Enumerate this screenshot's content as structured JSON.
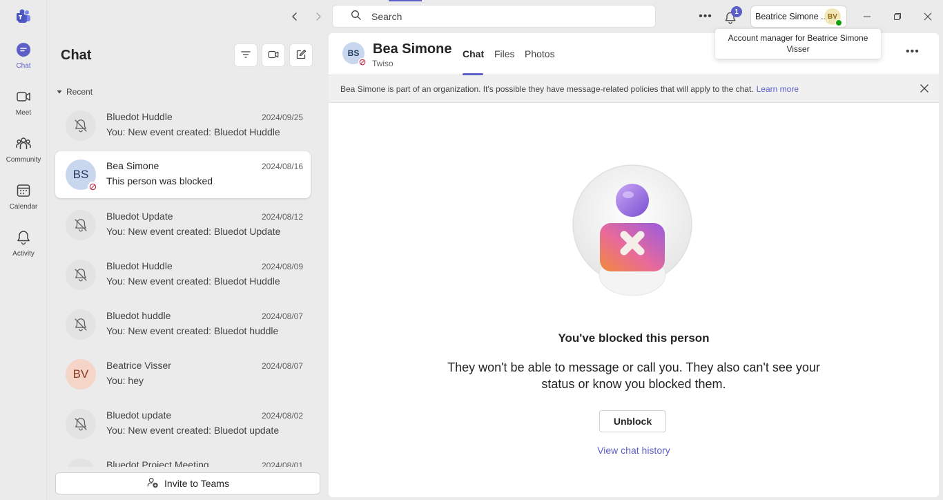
{
  "rail": {
    "items": [
      {
        "label": "Chat",
        "icon": "chat-icon"
      },
      {
        "label": "Meet",
        "icon": "video-icon"
      },
      {
        "label": "Community",
        "icon": "community-icon"
      },
      {
        "label": "Calendar",
        "icon": "calendar-icon"
      },
      {
        "label": "Activity",
        "icon": "bell-icon"
      }
    ]
  },
  "topbar": {
    "search_label": "Search",
    "notification_count": "1",
    "account_name": "Beatrice Simone ...",
    "account_initials": "BV",
    "tooltip": "Account manager for Beatrice Simone Visser"
  },
  "chat_list": {
    "title": "Chat",
    "section": "Recent",
    "items": [
      {
        "name": "Bluedot Huddle",
        "date": "2024/09/25",
        "preview": "You: New event created: Bluedot Huddle",
        "avatar": "muted-bell-icon"
      },
      {
        "name": "Bea Simone",
        "date": "2024/08/16",
        "preview": "This person was blocked",
        "initials": "BS"
      },
      {
        "name": "Bluedot Update",
        "date": "2024/08/12",
        "preview": "You: New event created: Bluedot Update",
        "avatar": "muted-bell-icon"
      },
      {
        "name": "Bluedot Huddle",
        "date": "2024/08/09",
        "preview": "You: New event created: Bluedot Huddle",
        "avatar": "muted-bell-icon"
      },
      {
        "name": "Bluedot huddle",
        "date": "2024/08/07",
        "preview": "You: New event created: Bluedot huddle",
        "avatar": "muted-bell-icon"
      },
      {
        "name": "Beatrice Visser",
        "date": "2024/08/07",
        "preview": "You: hey",
        "initials": "BV"
      },
      {
        "name": "Bluedot update",
        "date": "2024/08/02",
        "preview": "You: New event created: Bluedot update",
        "avatar": "muted-bell-icon"
      },
      {
        "name": "Bluedot Project Meeting",
        "date": "2024/08/01",
        "preview": "",
        "avatar": "muted-bell-icon"
      }
    ],
    "invite_label": "Invite to Teams"
  },
  "conversation": {
    "initials": "BS",
    "name": "Bea Simone",
    "subtitle": "Twiso",
    "tabs": [
      "Chat",
      "Files",
      "Photos"
    ],
    "banner_text": "Bea Simone is part of an organization. It's possible they have message-related policies that will apply to the chat.",
    "banner_link": "Learn more",
    "blocked_title": "You've blocked this person",
    "blocked_description": "They won't be able to message or call you. They also can't see your status or know you blocked them.",
    "unblock_label": "Unblock",
    "history_link": "View chat history"
  },
  "colors": {
    "accent": "#5b5fc7",
    "background": "#ebebeb",
    "blocked": "#c4314b",
    "available": "#13a10e"
  }
}
